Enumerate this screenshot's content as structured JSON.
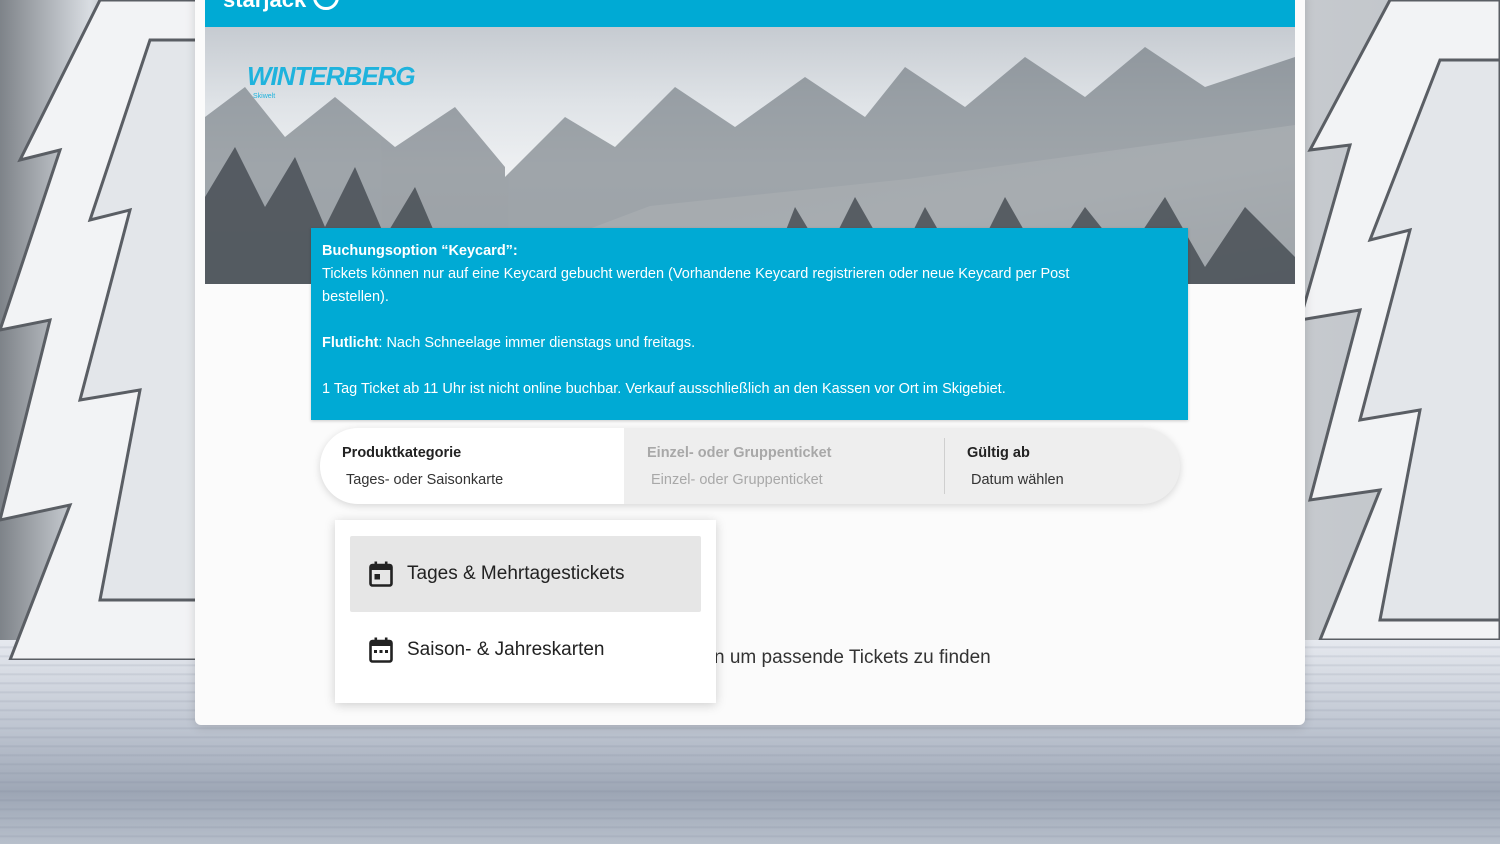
{
  "header": {
    "brand": "starjack",
    "logo_text": "WINTERBERG",
    "logo_sub": "Skiwelt"
  },
  "info": {
    "keycard_title": "Buchungsoption “Keycard”:",
    "keycard_text": "Tickets können nur auf eine Keycard gebucht werden (Vorhandene Keycard registrieren oder neue Keycard per Post bestellen).",
    "flutlicht_label": "Flutlicht",
    "flutlicht_text": ": Nach Schneelage immer dienstags und freitags.",
    "notice": "1 Tag Ticket ab 11 Uhr ist nicht online buchbar. Verkauf ausschließlich an den Kassen vor Ort im Skigebiet."
  },
  "filter": {
    "category_label": "Produktkategorie",
    "category_value": "Tages- oder Saisonkarte",
    "group_label": "Einzel- oder Gruppenticket",
    "group_value": "Einzel- oder Gruppenticket",
    "date_label": "Gültig ab",
    "date_value": "Datum wählen"
  },
  "dropdown": {
    "options": [
      {
        "label": "Tages & Mehrtagestickets",
        "icon": "calendar-day-icon",
        "selected": true
      },
      {
        "label": "Saison- & Jahreskarten",
        "icon": "calendar-dots-icon",
        "selected": false
      }
    ]
  },
  "hint": "n um passende Tickets zu finden",
  "colors": {
    "accent": "#00aad4",
    "logo": "#1fb3dd"
  }
}
